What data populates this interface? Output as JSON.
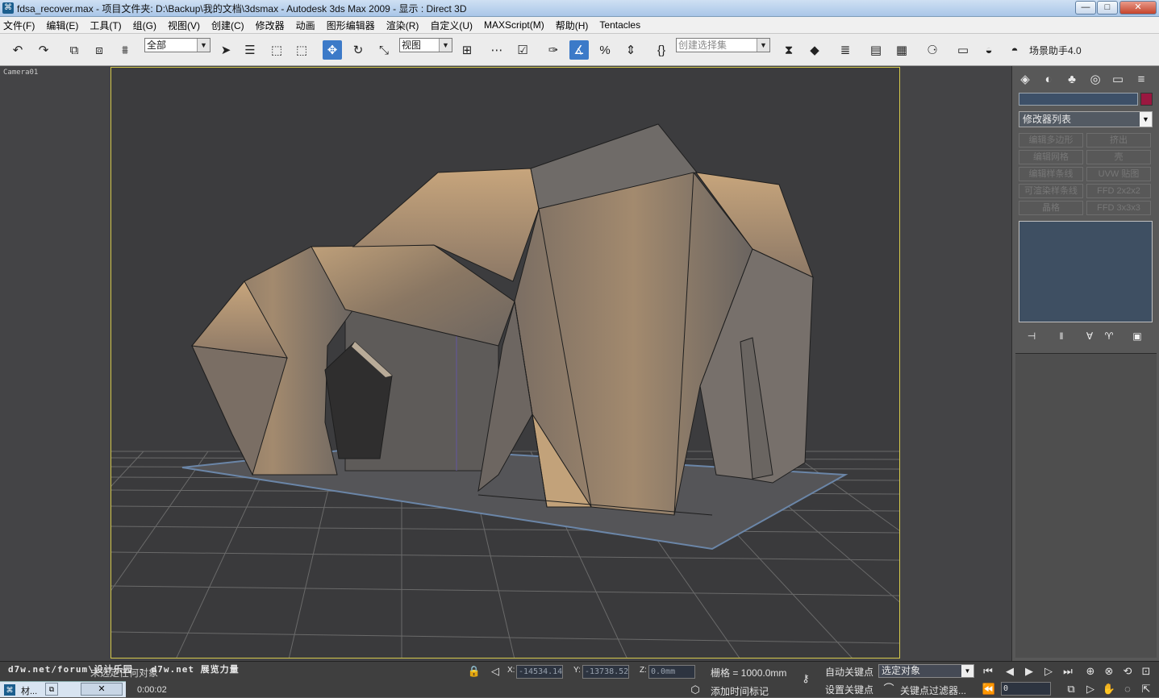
{
  "titlebar": {
    "text": "fdsa_recover.max    - 项目文件夹: D:\\Backup\\我的文档\\3dsmax    - Autodesk 3ds Max  2009     - 显示 : Direct 3D",
    "minimize": "—",
    "maximize": "□",
    "close": "✕"
  },
  "menu": [
    "文件(F)",
    "编辑(E)",
    "工具(T)",
    "组(G)",
    "视图(V)",
    "创建(C)",
    "修改器",
    "动画",
    "图形编辑器",
    "渲染(R)",
    "自定义(U)",
    "MAXScript(M)",
    "帮助(H)",
    "Tentacles"
  ],
  "toolbar": {
    "selection_filter": "全部",
    "ref_coord": "视图",
    "named_selection": "创建选择集",
    "helper": "场景助手4.0",
    "angle_snap_label": "3"
  },
  "viewport": {
    "label": "Camera01"
  },
  "panel": {
    "modifier_list": "修改器列表",
    "buttons": [
      [
        "编辑多边形",
        "挤出"
      ],
      [
        "编辑网格",
        "壳"
      ],
      [
        "编辑样条线",
        "UVW 贴图"
      ],
      [
        "可渲染样条线",
        "FFD 2x2x2"
      ],
      [
        "晶格",
        "FFD 3x3x3"
      ]
    ]
  },
  "status": {
    "watermark": "d7w.net/forum\\设计乐园 - d7w.net 展览力量",
    "selection_text": "未选定任何对象",
    "x_label": "X:",
    "x_value": "-14534.14",
    "y_label": "Y:",
    "y_value": "-13738.52",
    "z_label": "Z:",
    "z_value": "0.0mm",
    "grid": "栅格 = 1000.0mm",
    "auto_key": "自动关键点",
    "set_key": "设置关键点",
    "key_mode": "选定对象",
    "key_filter": "关键点过滤器...",
    "add_time_tag": "添加时间标记",
    "time": "0:00:02",
    "frame": "0",
    "task_label": "材...",
    "task_close": "✕"
  }
}
